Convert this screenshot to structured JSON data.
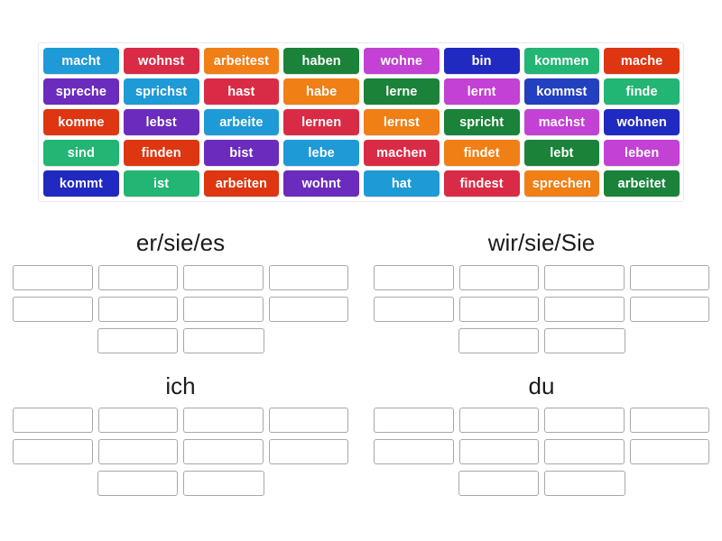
{
  "word_bank": {
    "rows": [
      [
        {
          "label": "macht",
          "color": "#1e9ad6"
        },
        {
          "label": "wohnst",
          "color": "#d92b45"
        },
        {
          "label": "arbeitest",
          "color": "#f07f16"
        },
        {
          "label": "haben",
          "color": "#1a8239"
        },
        {
          "label": "wohne",
          "color": "#c341d4"
        },
        {
          "label": "bin",
          "color": "#2029c0"
        },
        {
          "label": "kommen",
          "color": "#22b573"
        },
        {
          "label": "mache",
          "color": "#dd3611"
        }
      ],
      [
        {
          "label": "spreche",
          "color": "#6b2bbd"
        },
        {
          "label": "sprichst",
          "color": "#1e9ad6"
        },
        {
          "label": "hast",
          "color": "#d92b45"
        },
        {
          "label": "habe",
          "color": "#f07f16"
        },
        {
          "label": "lerne",
          "color": "#1a8239"
        },
        {
          "label": "lernt",
          "color": "#c341d4"
        },
        {
          "label": "kommst",
          "color": "#2340c0"
        },
        {
          "label": "finde",
          "color": "#22b573"
        }
      ],
      [
        {
          "label": "komme",
          "color": "#dd3611"
        },
        {
          "label": "lebst",
          "color": "#6b2bbd"
        },
        {
          "label": "arbeite",
          "color": "#1e9ad6"
        },
        {
          "label": "lernen",
          "color": "#d92b45"
        },
        {
          "label": "lernst",
          "color": "#f07f16"
        },
        {
          "label": "spricht",
          "color": "#1a8239"
        },
        {
          "label": "machst",
          "color": "#c341d4"
        },
        {
          "label": "wohnen",
          "color": "#2029c0"
        }
      ],
      [
        {
          "label": "sind",
          "color": "#22b573"
        },
        {
          "label": "finden",
          "color": "#dd3611"
        },
        {
          "label": "bist",
          "color": "#6b2bbd"
        },
        {
          "label": "lebe",
          "color": "#1e9ad6"
        },
        {
          "label": "machen",
          "color": "#d92b45"
        },
        {
          "label": "findet",
          "color": "#f07f16"
        },
        {
          "label": "lebt",
          "color": "#1a8239"
        },
        {
          "label": "leben",
          "color": "#c341d4"
        }
      ],
      [
        {
          "label": "kommt",
          "color": "#2029c0"
        },
        {
          "label": "ist",
          "color": "#22b573"
        },
        {
          "label": "arbeiten",
          "color": "#dd3611"
        },
        {
          "label": "wohnt",
          "color": "#6b2bbd"
        },
        {
          "label": "hat",
          "color": "#1e9ad6"
        },
        {
          "label": "findest",
          "color": "#d92b45"
        },
        {
          "label": "sprechen",
          "color": "#f07f16"
        },
        {
          "label": "arbeitet",
          "color": "#1a8239"
        }
      ]
    ]
  },
  "sections": [
    {
      "title": "er/sie/es",
      "slot_count": 10
    },
    {
      "title": "wir/sie/Sie",
      "slot_count": 10
    },
    {
      "title": "ich",
      "slot_count": 10
    },
    {
      "title": "du",
      "slot_count": 10
    }
  ]
}
